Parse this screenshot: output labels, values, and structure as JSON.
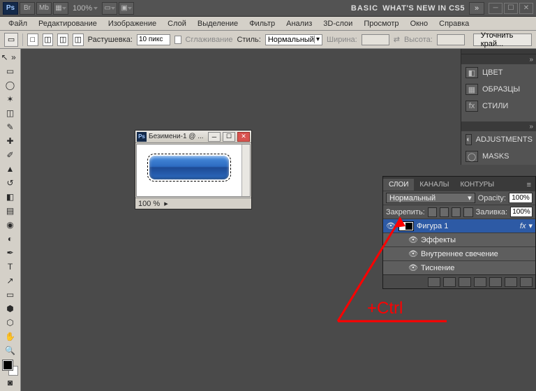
{
  "appbar": {
    "ps": "Ps",
    "br": "Br",
    "mb": "Mb",
    "zoom": "100%",
    "basic": "BASIC",
    "whats": "WHAT'S NEW IN CS5",
    "arrows": "»"
  },
  "menu": {
    "items": [
      "Файл",
      "Редактирование",
      "Изображение",
      "Слой",
      "Выделение",
      "Фильтр",
      "Анализ",
      "3D-слои",
      "Просмотр",
      "Окно",
      "Справка"
    ]
  },
  "opt": {
    "feather_label": "Растушевка:",
    "feather_val": "10 пикс",
    "antialias": "Сглаживание",
    "style_label": "Стиль:",
    "style_val": "Нормальный",
    "width_label": "Ширина:",
    "height_label": "Высота:",
    "refine": "Уточнить край..."
  },
  "dock": {
    "items": [
      "ЦВЕТ",
      "ОБРАЗЦЫ",
      "СТИЛИ"
    ],
    "items2": [
      "ADJUSTMENTS",
      "MASKS"
    ]
  },
  "layers": {
    "tabs": [
      "СЛОИ",
      "КАНАЛЫ",
      "КОНТУРЫ"
    ],
    "blend": "Нормальный",
    "opacity_label": "Opacity:",
    "opacity": "100%",
    "lock_label": "Закрепить:",
    "fill_label": "Заливка:",
    "fill": "100%",
    "layer1": "Фигура 1",
    "fx": "fx",
    "effects": "Эффекты",
    "inner_glow": "Внутреннее свечение",
    "bevel": "Тиснение"
  },
  "docwin": {
    "title": "Безимени-1 @ ...",
    "zoom": "100 %"
  },
  "annot": {
    "text": "+Ctrl"
  }
}
